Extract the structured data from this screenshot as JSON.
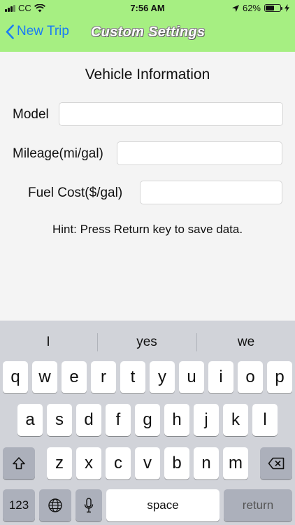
{
  "status": {
    "carrier": "CC",
    "time": "7:56 AM",
    "battery": "62%",
    "battery_level": 0.62
  },
  "nav": {
    "back_label": "New Trip",
    "title": "Custom Settings"
  },
  "form": {
    "section_title": "Vehicle Information",
    "fields": [
      {
        "label": "Model",
        "value": ""
      },
      {
        "label": "Mileage(mi/gal)",
        "value": ""
      },
      {
        "label": "Fuel Cost($/gal)",
        "value": ""
      }
    ],
    "hint": "Hint: Press Return key to save data."
  },
  "keyboard": {
    "predictions": [
      "I",
      "yes",
      "we"
    ],
    "row1": [
      "q",
      "w",
      "e",
      "r",
      "t",
      "y",
      "u",
      "i",
      "o",
      "p"
    ],
    "row2": [
      "a",
      "s",
      "d",
      "f",
      "g",
      "h",
      "j",
      "k",
      "l"
    ],
    "row3": [
      "z",
      "x",
      "c",
      "v",
      "b",
      "n",
      "m"
    ],
    "numbers_label": "123",
    "space_label": "space",
    "return_label": "return"
  },
  "colors": {
    "nav_bg": "#a6ef82",
    "link": "#1a7cf5",
    "keyboard_bg": "#d1d3d9"
  }
}
